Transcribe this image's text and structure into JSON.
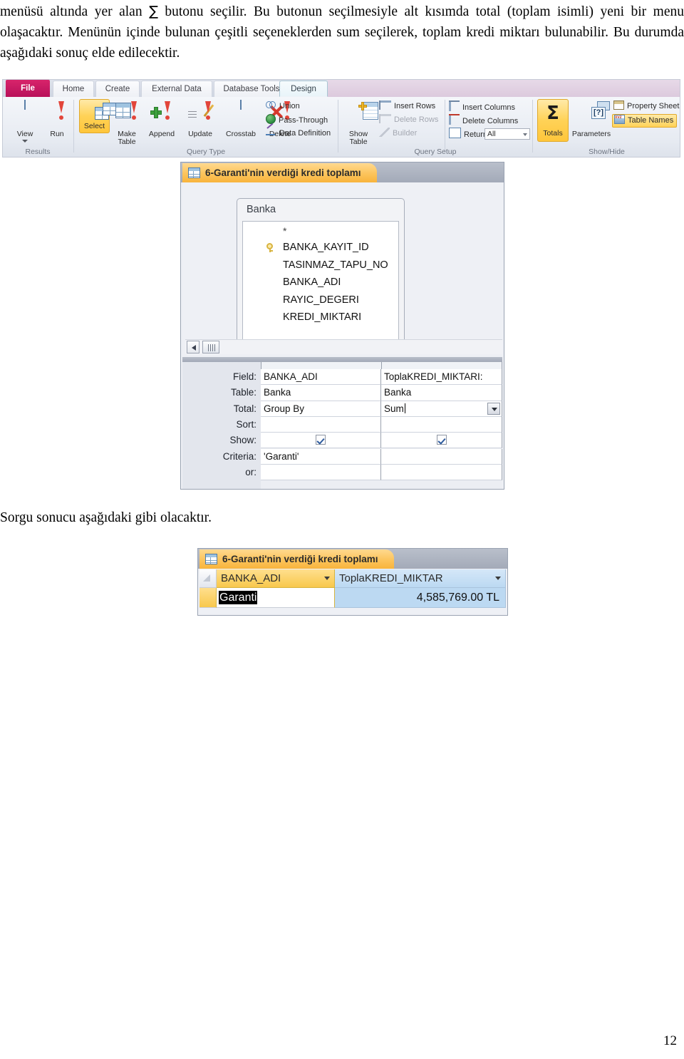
{
  "document": {
    "paragraph1_part1": "menüsü altında yer alan ",
    "sigma_symbol": "∑",
    "paragraph1_part2": " butonu seçilir. Bu butonun seçilmesiyle alt kısımda total (toplam isimli) yeni bir menu olaşacaktır. Menünün içinde bulunan çeşitli seçeneklerden sum seçilerek, toplam kredi miktarı bulunabilir. Bu durumda aşağıdaki sonuç elde edilecektir.",
    "paragraph2": "Sorgu sonucu aşağıdaki gibi olacaktır.",
    "page_number": "12"
  },
  "ribbon": {
    "tabs": [
      {
        "label": "File",
        "active": false
      },
      {
        "label": "Home",
        "active": false
      },
      {
        "label": "Create",
        "active": false
      },
      {
        "label": "External Data",
        "active": false
      },
      {
        "label": "Database Tools",
        "active": false
      },
      {
        "label": "Design",
        "active": true
      }
    ],
    "groups": {
      "results": {
        "label": "Results",
        "buttons": [
          {
            "label": "View",
            "sublabel": "",
            "icon": "table-view-icon",
            "has_dropdown": true
          },
          {
            "label": "Run",
            "sublabel": "",
            "icon": "run-exclamation-icon",
            "has_dropdown": false
          }
        ]
      },
      "query_type": {
        "label": "Query Type",
        "buttons": [
          {
            "label": "Select",
            "sublabel": "",
            "icon": "select-query-icon",
            "selected": true
          },
          {
            "label": "Make",
            "sublabel": "Table",
            "icon": "make-table-icon",
            "selected": false
          },
          {
            "label": "Append",
            "sublabel": "",
            "icon": "append-query-icon",
            "selected": false
          },
          {
            "label": "Update",
            "sublabel": "",
            "icon": "update-query-icon",
            "selected": false
          },
          {
            "label": "Crosstab",
            "sublabel": "",
            "icon": "crosstab-query-icon",
            "selected": false
          },
          {
            "label": "Delete",
            "sublabel": "",
            "icon": "delete-query-icon",
            "selected": false
          }
        ],
        "small_items": [
          {
            "label": "Union",
            "icon": "union-icon",
            "disabled": false
          },
          {
            "label": "Pass-Through",
            "icon": "pass-through-globe-icon",
            "disabled": false
          },
          {
            "label": "Data Definition",
            "icon": "data-definition-icon",
            "disabled": false
          }
        ]
      },
      "query_setup": {
        "label": "Query Setup",
        "show_table_label": "Show",
        "show_table_sublabel": "Table",
        "small_items_col1": [
          {
            "label": "Insert Rows",
            "icon": "insert-rows-icon",
            "disabled": false
          },
          {
            "label": "Delete Rows",
            "icon": "delete-rows-icon",
            "disabled": true
          },
          {
            "label": "Builder",
            "icon": "builder-icon",
            "disabled": true
          }
        ],
        "small_items_col2": [
          {
            "label": "Insert Columns",
            "icon": "insert-columns-icon",
            "disabled": false
          },
          {
            "label": "Delete Columns",
            "icon": "delete-columns-icon",
            "disabled": false
          }
        ],
        "return_label": "Return:",
        "return_value": "All"
      },
      "show_hide": {
        "label": "Show/Hide",
        "buttons": [
          {
            "label": "Totals",
            "icon": "sigma-totals-icon",
            "selected": true
          },
          {
            "label": "Parameters",
            "icon": "parameters-icon",
            "selected": false
          }
        ],
        "small_items": [
          {
            "label": "Property Sheet",
            "icon": "property-sheet-icon",
            "selected": false
          },
          {
            "label": "Table Names",
            "icon": "table-names-icon",
            "selected": true
          }
        ]
      }
    }
  },
  "query_design_window": {
    "tab_title": "6-Garanti'nin verdiği kredi toplamı",
    "field_list": {
      "table_name": "Banka",
      "fields": [
        {
          "name": "*",
          "is_key": false
        },
        {
          "name": "BANKA_KAYIT_ID",
          "is_key": true
        },
        {
          "name": "TASINMAZ_TAPU_NO",
          "is_key": false
        },
        {
          "name": "BANKA_ADI",
          "is_key": false
        },
        {
          "name": "RAYIC_DEGERI",
          "is_key": false
        },
        {
          "name": "KREDI_MIKTARI",
          "is_key": false
        }
      ]
    },
    "grid": {
      "row_labels": [
        "Field:",
        "Table:",
        "Total:",
        "Sort:",
        "Show:",
        "Criteria:",
        "or:"
      ],
      "columns": [
        {
          "field": "BANKA_ADI",
          "table": "Banka",
          "total": "Group By",
          "sort": "",
          "show": true,
          "criteria": "'Garanti'",
          "or": ""
        },
        {
          "field": "ToplaKREDI_MIKTARI:",
          "table": "Banka",
          "total": "Sum",
          "total_has_caret": true,
          "total_has_dropdown": true,
          "sort": "",
          "show": true,
          "criteria": "",
          "or": ""
        }
      ]
    }
  },
  "result_datasheet": {
    "tab_title": "6-Garanti'nin verdiği kredi toplamı",
    "columns": [
      {
        "header": "BANKA_ADI",
        "selected": true
      },
      {
        "header": "ToplaKREDI_MIKTAR",
        "selected": false
      }
    ],
    "rows": [
      {
        "banka_adi": "Garanti",
        "banka_adi_selected": true,
        "toplam": "4,585,769.00 TL"
      }
    ]
  },
  "colors": {
    "file_tab": "#c8145f",
    "selected_gold": "#ffd257",
    "tab_orange": "#fcc45c",
    "datasheet_blue": "#bcd9f2",
    "ribbon_bg": "#e7ebf2"
  }
}
